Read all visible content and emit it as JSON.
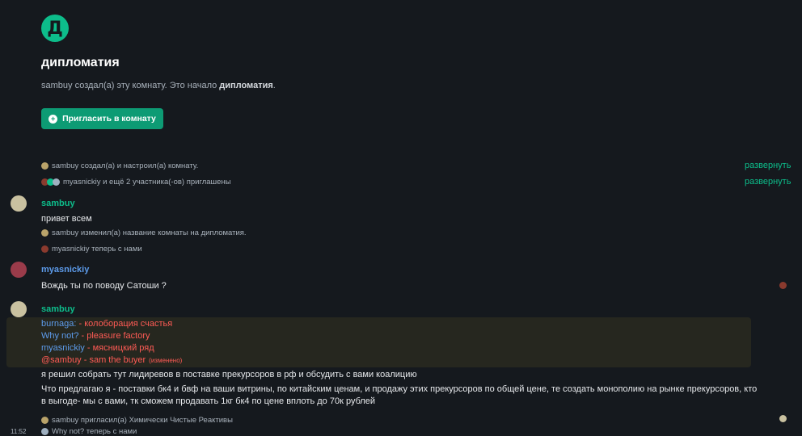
{
  "room": {
    "avatar_letter": "Д",
    "name": "дипломатия",
    "intro_prefix": "sambuy создал(а) эту комнату. Это начало ",
    "intro_bold": "дипломатия",
    "intro_suffix": ".",
    "invite_label": "Пригласить в комнату"
  },
  "events": {
    "created": "sambuy создал(а) и настроил(а) комнату.",
    "invited": "myasnickiy и ещё 2 участника(-ов) приглашены",
    "expand_label": "развернуть",
    "renamed": "sambuy изменил(а) название комнаты на дипломатия.",
    "joined": "myasnickiy теперь с нами",
    "invited_ccr": "sambuy пригласил(а) Химически Чистые Реактивы",
    "cut_off": "Why not? теперь с нами"
  },
  "messages": [
    {
      "sender": "sambuy",
      "text": "привет всем"
    },
    {
      "sender": "myasnickiy",
      "text": "Вождь ты по поводу Сатоши ?"
    },
    {
      "sender": "sambuy"
    }
  ],
  "highlight": {
    "lines": [
      {
        "who": "burnaga:",
        "rest": " - колоборация счастья"
      },
      {
        "who": "Why not?",
        "rest": " - pleasure factory"
      },
      {
        "who": "myasnickiy",
        "rest": " - мясницкий ряд"
      }
    ],
    "last_line": "@sambuy - sam the buyer",
    "edited": "(изменено)"
  },
  "body_text": {
    "line1": "я решил собрать тут лидиревов в поставке прекурсоров в рф и обсудить с вами коалицию",
    "line2": "Что предлагаю я -  поставки бк4 и бвф на ваши витрины, по китайским ценам, и продажу этих прекурсоров по общей цене, те создать монополию на рынке прекурсоров, кто",
    "line3": "в выгоде- мы с вами, тк сможем продавать 1кг бк4 по цене вплоть до 70к рублей"
  },
  "timestamp": "11:52",
  "colors": {
    "accent": "#0dbd8b",
    "link_blue": "#5d9cec",
    "mention_red": "#ff5b55",
    "background": "#15191e"
  }
}
